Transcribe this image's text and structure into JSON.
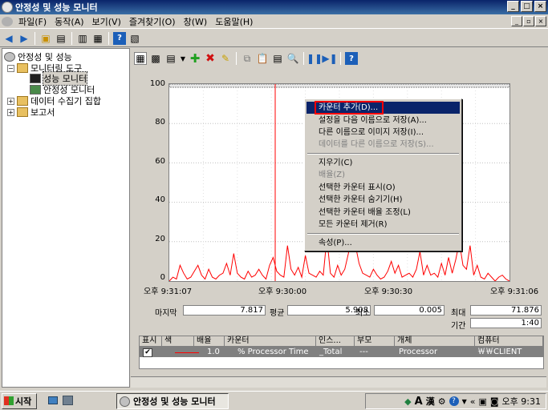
{
  "window": {
    "title": "안정성 및 성능 모니터"
  },
  "menu": {
    "items": [
      "파일(F)",
      "동작(A)",
      "보기(V)",
      "즐겨찾기(O)",
      "창(W)",
      "도움말(H)"
    ]
  },
  "title_buttons": {
    "min": "_",
    "max": "□",
    "close": "×"
  },
  "mdi_buttons": {
    "min": "_",
    "restore": "▫",
    "close": "×"
  },
  "tree": {
    "root": "안정성 및 성능",
    "monitoring_tools": "모니터링 도구",
    "perf_monitor": "성능 모니터",
    "reliability_monitor": "안정성 모니터",
    "data_collector_sets": "데이터 수집기 집합",
    "reports": "보고서"
  },
  "graph": {
    "y_ticks": [
      "100",
      "80",
      "60",
      "40",
      "20",
      "0"
    ],
    "x_ticks": [
      "오후 9:31:07",
      "오후 9:30:00",
      "오후 9:30:30",
      "오후 9:31:06"
    ],
    "line_color": "#ff0000"
  },
  "chart_data": {
    "type": "line",
    "ylim": [
      0,
      100
    ],
    "values": [
      0,
      2,
      1,
      8,
      4,
      1,
      2,
      5,
      8,
      3,
      1,
      6,
      2,
      1,
      3,
      4,
      9,
      3,
      14,
      4,
      2,
      1,
      5,
      2,
      3,
      6,
      3,
      1,
      8,
      12,
      5,
      3,
      2,
      18,
      6,
      3,
      7,
      2,
      13,
      4,
      3,
      2,
      5,
      3,
      22,
      4,
      2,
      8,
      3,
      6,
      14,
      25,
      18,
      9,
      4,
      3,
      2,
      6,
      3,
      1,
      2,
      5,
      10,
      4,
      8,
      2,
      3,
      4,
      2,
      6,
      15,
      3,
      8,
      3,
      4,
      2,
      9,
      3,
      12,
      4,
      11,
      20,
      8,
      6,
      18,
      3,
      8,
      2,
      1,
      4,
      2,
      0,
      2,
      3,
      1,
      0
    ]
  },
  "stats": {
    "last_label": "마지막",
    "last_value": "7.817",
    "avg_label": "평균",
    "avg_value": "5.908",
    "min_label": "최소",
    "min_value": "0.005",
    "max_label": "최대",
    "max_value": "71.876",
    "duration_label": "기간",
    "duration_value": "1:40"
  },
  "counter_table": {
    "headers": [
      "표시",
      "색",
      "배율",
      "카운터",
      "인스...",
      "부모",
      "개체",
      "컴퓨터"
    ],
    "row": {
      "show": "✔",
      "scale": "1.0",
      "counter": "% Processor Time",
      "instance": "_Total",
      "parent": "---",
      "object": "Processor",
      "computer": "￦￦CLIENT"
    }
  },
  "context_menu": {
    "items": [
      "카운터 추가(D)...",
      "설정을 다음 이름으로 저장(A)...",
      "다른 이름으로 이미지 저장(I)...",
      "데이터를 다른 이름으로 저장(S)...",
      "지우기(C)",
      "배율(Z)",
      "선택한 카운터 표시(O)",
      "선택한 카운터 숨기기(H)",
      "선택한 카운터 배율 조정(L)",
      "모든 카운터 제거(R)",
      "속성(P)..."
    ]
  },
  "taskbar": {
    "start": "시작",
    "task": "안정성 및 성능 모니터",
    "clock": "오후 9:31",
    "ime_a": "A",
    "ime_han": "漢"
  }
}
